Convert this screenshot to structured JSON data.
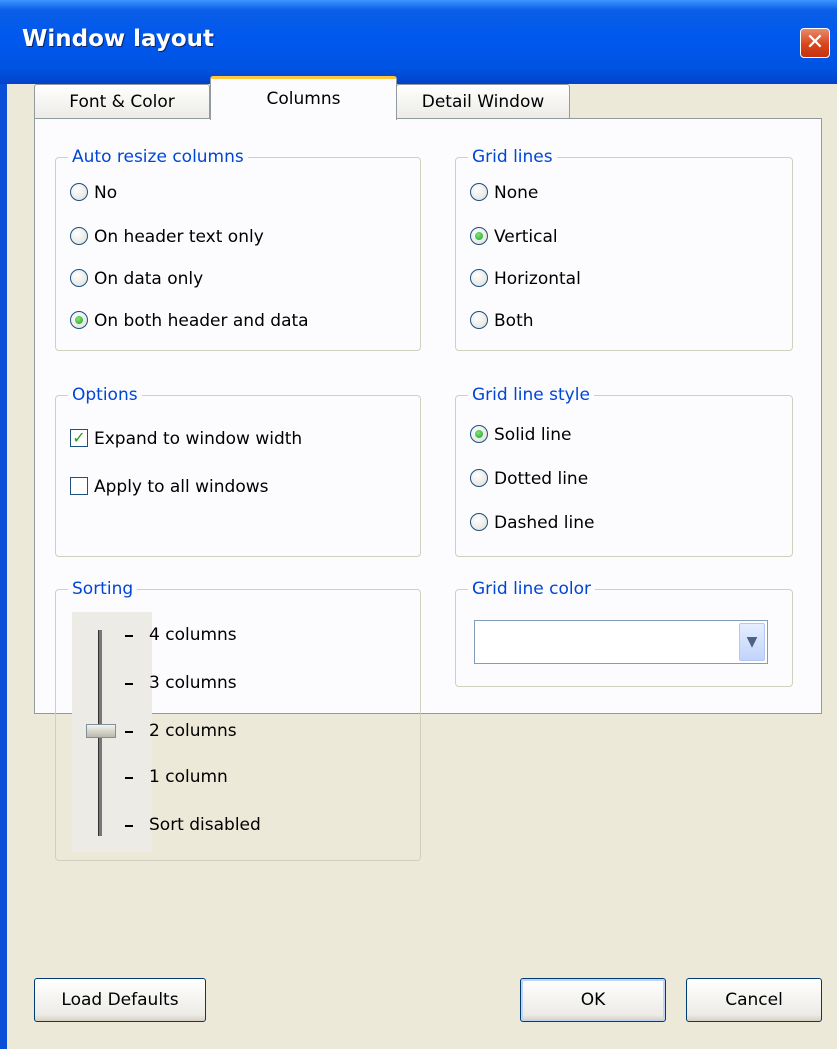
{
  "window": {
    "title": "Window layout"
  },
  "tabs": [
    {
      "label": "Font & Color",
      "active": false
    },
    {
      "label": "Columns",
      "active": true
    },
    {
      "label": "Detail Window",
      "active": false
    }
  ],
  "auto_resize": {
    "title": "Auto resize columns",
    "options": [
      {
        "label": "No",
        "checked": false
      },
      {
        "label": "On header text only",
        "checked": false
      },
      {
        "label": "On data only",
        "checked": false
      },
      {
        "label": "On both header and data",
        "checked": true
      }
    ]
  },
  "grid_lines": {
    "title": "Grid lines",
    "options": [
      {
        "label": "None",
        "checked": false
      },
      {
        "label": "Vertical",
        "checked": true
      },
      {
        "label": "Horizontal",
        "checked": false
      },
      {
        "label": "Both",
        "checked": false
      }
    ]
  },
  "options": {
    "title": "Options",
    "items": [
      {
        "label": "Expand to window width",
        "checked": true
      },
      {
        "label": "Apply to all windows",
        "checked": false
      }
    ]
  },
  "grid_line_style": {
    "title": "Grid line style",
    "options": [
      {
        "label": "Solid line",
        "checked": true
      },
      {
        "label": "Dotted line",
        "checked": false
      },
      {
        "label": "Dashed line",
        "checked": false
      }
    ]
  },
  "sorting": {
    "title": "Sorting",
    "ticks": [
      "4 columns",
      "3 columns",
      "2 columns",
      "1 column",
      "Sort disabled"
    ],
    "selected": "2 columns"
  },
  "grid_line_color": {
    "title": "Grid line color",
    "value": ""
  },
  "buttons": {
    "load_defaults": "Load Defaults",
    "ok": "OK",
    "cancel": "Cancel"
  }
}
